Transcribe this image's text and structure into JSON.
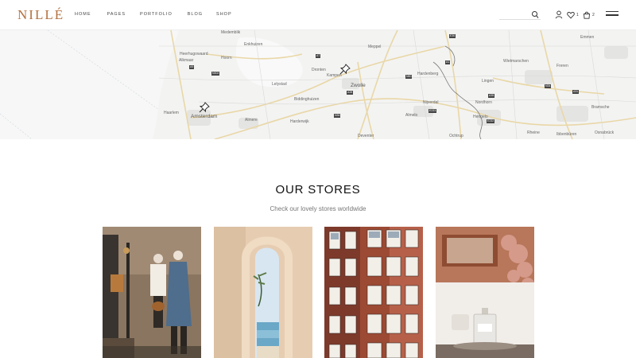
{
  "header": {
    "logo": "NILLÉ",
    "nav": [
      "HOME",
      "PAGES",
      "PORTFOLIO",
      "BLOG",
      "SHOP"
    ],
    "wishlist_count": "1",
    "cart_count": "2"
  },
  "map": {
    "labels": [
      "Medemblik",
      "Heerhugowaard",
      "Alkmaar",
      "Hoorn",
      "Enkhuizen",
      "Lelystad",
      "Dronten",
      "Kampen",
      "Zwolle",
      "Emmen",
      "Meppel",
      "Hardenberg",
      "Haarlem",
      "Amsterdam",
      "Almere",
      "Harderwijk",
      "Biddinghuizen",
      "Nijverdal",
      "Almelo",
      "Hengelo",
      "Nordhorn",
      "Lingen",
      "Rheine",
      "Bramsche",
      "Osnabrück",
      "Deventer",
      "Ibbenbüren",
      "Ochtrup",
      "Wietmarschen",
      "Freren"
    ],
    "roads": [
      "A7",
      "A9",
      "N302",
      "N50",
      "A28",
      "A1",
      "E30",
      "A35",
      "E233",
      "N34",
      "A31",
      "E232",
      "N36"
    ]
  },
  "stores": {
    "title": "OUR STORES",
    "subtitle": "Check our lovely stores worldwide"
  }
}
